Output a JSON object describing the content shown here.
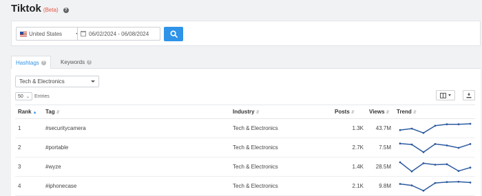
{
  "header": {
    "title": "Tiktok",
    "beta": "(Beta)"
  },
  "filters": {
    "country": "United States",
    "date_range": "06/02/2024 - 06/08/2024"
  },
  "tabs": [
    {
      "label": "Hashtags",
      "active": true
    },
    {
      "label": "Keywords",
      "active": false
    }
  ],
  "category": "Tech & Electronics",
  "entries": {
    "value": "50",
    "label": "Entries"
  },
  "table": {
    "columns": [
      "Rank",
      "Tag",
      "Industry",
      "Posts",
      "Views",
      "Trend"
    ],
    "rows": [
      {
        "rank": "1",
        "tag": "#securitycamera",
        "industry": "Tech & Electronics",
        "posts": "1.3K",
        "views": "43.7M",
        "trend": [
          0.35,
          0.5,
          0.05,
          0.8,
          0.95,
          0.95,
          1.0
        ]
      },
      {
        "rank": "2",
        "tag": "#portable",
        "industry": "Tech & Electronics",
        "posts": "2.7K",
        "views": "7.5M",
        "trend": [
          0.95,
          0.85,
          0.05,
          0.9,
          0.75,
          0.5,
          0.9
        ]
      },
      {
        "rank": "3",
        "tag": "#wyze",
        "industry": "Tech & Electronics",
        "posts": "1.4K",
        "views": "28.5M",
        "trend": [
          1.0,
          0.05,
          0.9,
          0.75,
          0.8,
          0.1,
          0.45
        ]
      },
      {
        "rank": "4",
        "tag": "#iphonecase",
        "industry": "Tech & Electronics",
        "posts": "2.1K",
        "views": "9.8M",
        "trend": [
          0.75,
          0.6,
          0.05,
          0.85,
          0.95,
          0.98,
          0.9
        ]
      }
    ]
  },
  "colors": {
    "accent": "#2f93e8",
    "beta": "#e8523f",
    "spark": "#2c5aa0"
  }
}
